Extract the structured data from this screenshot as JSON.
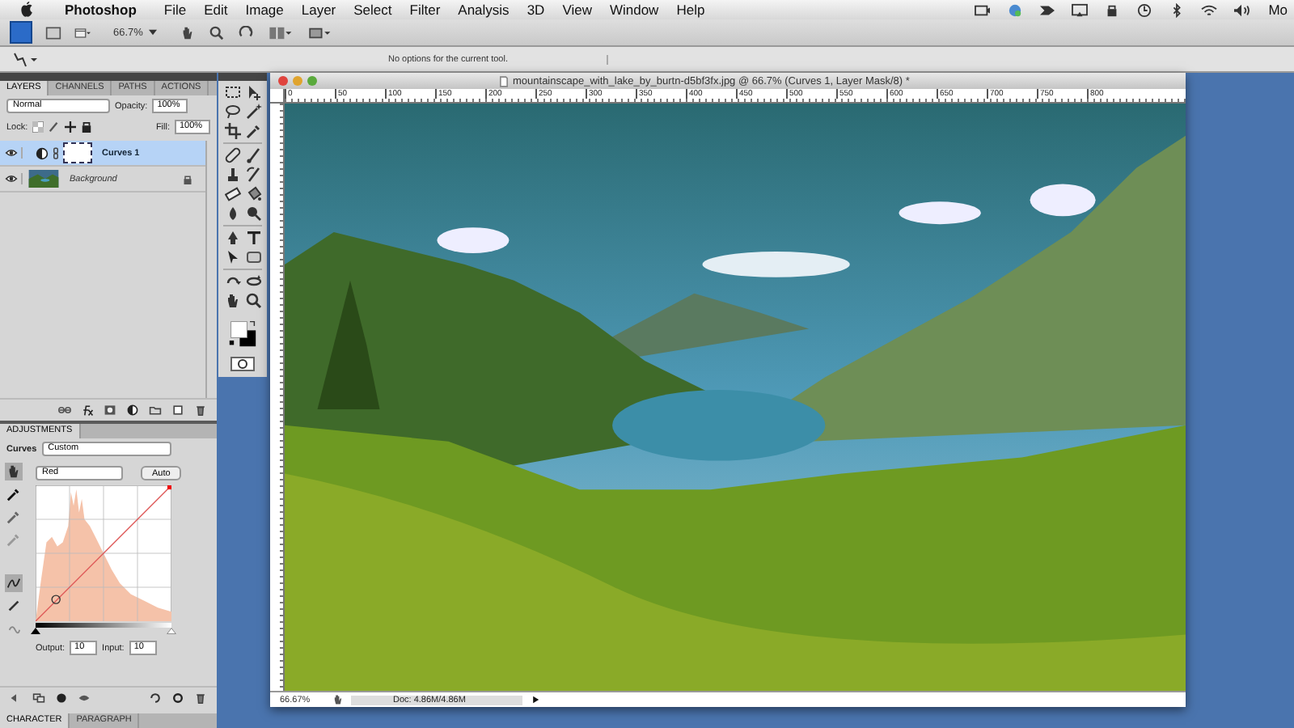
{
  "menu_bar": {
    "app": "Photoshop",
    "items": [
      "File",
      "Edit",
      "Image",
      "Layer",
      "Select",
      "Filter",
      "Analysis",
      "3D",
      "View",
      "Window",
      "Help"
    ],
    "clock": "Mo"
  },
  "app_bar": {
    "zoom": "66.7%"
  },
  "options_bar": {
    "message": "No options for the current tool."
  },
  "layers_panel": {
    "tabs": [
      {
        "label": "LAYERS",
        "selected": true
      },
      {
        "label": "CHANNELS",
        "selected": false
      },
      {
        "label": "PATHS",
        "selected": false
      },
      {
        "label": "ACTIONS",
        "selected": false
      }
    ],
    "blend_mode": "Normal",
    "opacity_label": "Opacity:",
    "opacity": "100%",
    "lock_label": "Lock:",
    "fill_label": "Fill:",
    "fill": "100%",
    "layers": [
      {
        "name": "Curves 1",
        "kind": "adjustment",
        "selected": true,
        "visible": true,
        "locked": false
      },
      {
        "name": "Background",
        "kind": "image",
        "selected": false,
        "visible": true,
        "locked": true
      }
    ]
  },
  "adjustments_panel": {
    "tab": "ADJUSTMENTS",
    "type_label": "Curves",
    "preset": "Custom",
    "channel": "Red",
    "auto_button": "Auto",
    "black_point": {
      "level": 0
    },
    "white_point": {
      "level": 1
    },
    "output_label": "Output:",
    "output": "10",
    "input_label": "Input:",
    "input": "10"
  },
  "bottom_tabs": [
    {
      "label": "CHARACTER",
      "selected": true
    },
    {
      "label": "PARAGRAPH",
      "selected": false
    }
  ],
  "document": {
    "title": "mountainscape_with_lake_by_burtn-d5bf3fx.jpg @ 66.7% (Curves 1, Layer Mask/8) *",
    "ruler": [
      "0",
      "50",
      "100",
      "150",
      "200",
      "250",
      "300",
      "350",
      "400",
      "450",
      "500",
      "550",
      "600",
      "650",
      "700",
      "750",
      "800"
    ],
    "zoom": "66.67%",
    "doc_info": "Doc: 4.86M/4.86M"
  }
}
